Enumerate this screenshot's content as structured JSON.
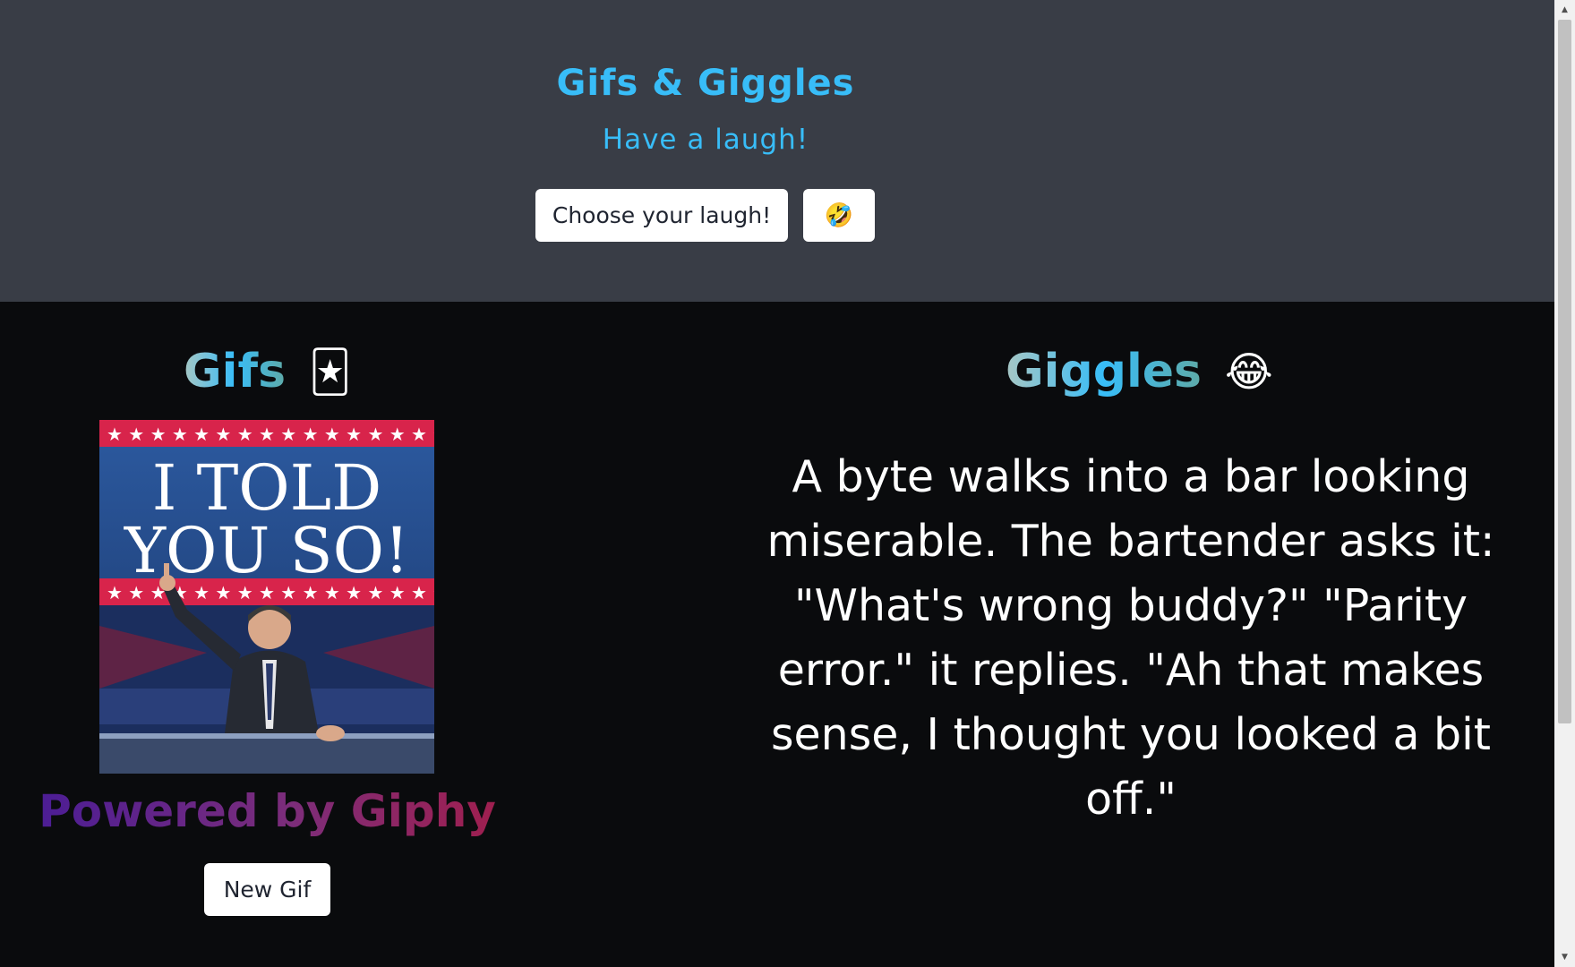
{
  "header": {
    "title": "Gifs & Giggles",
    "subtitle": "Have a laugh!",
    "choose_button_label": "Choose your laugh!",
    "emoji_button_label": "🤣"
  },
  "gifs_section": {
    "heading": "Gifs",
    "heading_emoji": "🃏",
    "gif_text_line1": "I TOLD",
    "gif_text_line2": "YOU SO!",
    "powered_by": "Powered by Giphy",
    "new_gif_label": "New Gif"
  },
  "giggles_section": {
    "heading": "Giggles",
    "heading_emoji": "😂",
    "joke": "A byte walks into a bar looking miserable. The bartender asks it: \"What's wrong buddy?\" \"Parity error.\" it replies. \"Ah that makes sense, I thought you looked a bit off.\""
  },
  "colors": {
    "header_bg": "#393d46",
    "main_bg": "#0a0b0d",
    "accent": "#38bdf8",
    "powered_gradient_start": "#4c1d95",
    "powered_gradient_end": "#9f1f4f"
  },
  "icons": {
    "emoji_button": "rofl-emoji-icon",
    "gifs_heading": "joker-card-icon",
    "giggles_heading": "tears-of-joy-icon"
  }
}
